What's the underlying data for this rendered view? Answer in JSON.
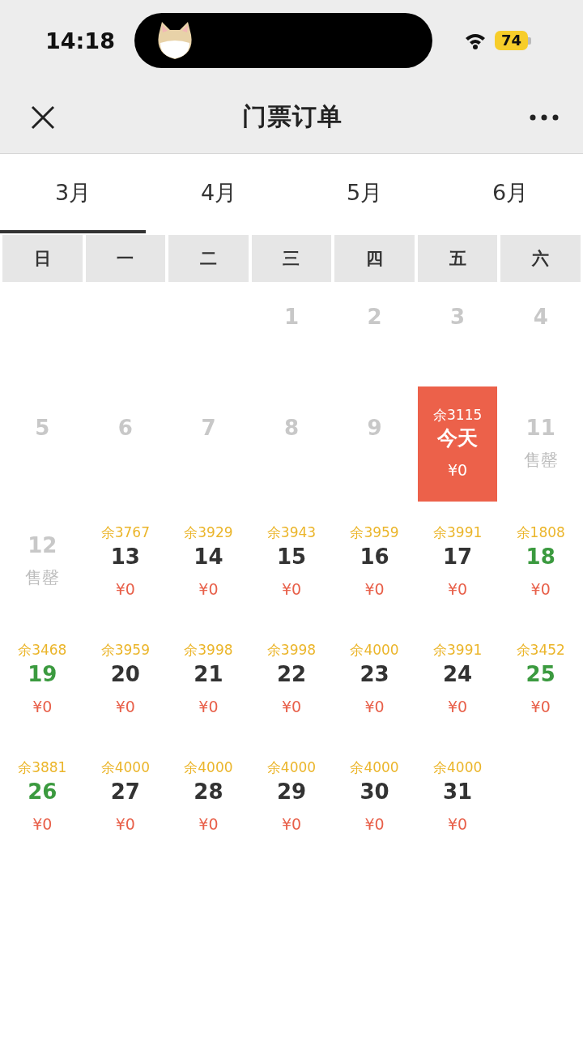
{
  "status_bar": {
    "time": "14:18",
    "battery": "74"
  },
  "nav_bar": {
    "title": "门票订单"
  },
  "month_tabs": [
    {
      "label": "3月",
      "selected": true
    },
    {
      "label": "4月",
      "selected": false
    },
    {
      "label": "5月",
      "selected": false
    },
    {
      "label": "6月",
      "selected": false
    }
  ],
  "weekdays": [
    "日",
    "一",
    "二",
    "三",
    "四",
    "五",
    "六"
  ],
  "weeks": [
    [
      {
        "kind": "empty"
      },
      {
        "kind": "empty"
      },
      {
        "kind": "empty"
      },
      {
        "kind": "past",
        "date": "1"
      },
      {
        "kind": "past",
        "date": "2"
      },
      {
        "kind": "past",
        "date": "3"
      },
      {
        "kind": "past",
        "date": "4"
      }
    ],
    [
      {
        "kind": "past",
        "date": "5"
      },
      {
        "kind": "past",
        "date": "6"
      },
      {
        "kind": "past",
        "date": "7"
      },
      {
        "kind": "past",
        "date": "8"
      },
      {
        "kind": "past",
        "date": "9"
      },
      {
        "kind": "today",
        "remaining": "余3115",
        "label": "今天",
        "price": "¥0"
      },
      {
        "kind": "soldout",
        "date": "11",
        "status": "售罄"
      }
    ],
    [
      {
        "kind": "soldout",
        "date": "12",
        "status": "售罄"
      },
      {
        "kind": "available",
        "remaining": "余3767",
        "date": "13",
        "weekend": false,
        "price": "¥0"
      },
      {
        "kind": "available",
        "remaining": "余3929",
        "date": "14",
        "weekend": false,
        "price": "¥0"
      },
      {
        "kind": "available",
        "remaining": "余3943",
        "date": "15",
        "weekend": false,
        "price": "¥0"
      },
      {
        "kind": "available",
        "remaining": "余3959",
        "date": "16",
        "weekend": false,
        "price": "¥0"
      },
      {
        "kind": "available",
        "remaining": "余3991",
        "date": "17",
        "weekend": false,
        "price": "¥0"
      },
      {
        "kind": "available",
        "remaining": "余1808",
        "date": "18",
        "weekend": true,
        "price": "¥0"
      }
    ],
    [
      {
        "kind": "available",
        "remaining": "余3468",
        "date": "19",
        "weekend": true,
        "price": "¥0"
      },
      {
        "kind": "available",
        "remaining": "余3959",
        "date": "20",
        "weekend": false,
        "price": "¥0"
      },
      {
        "kind": "available",
        "remaining": "余3998",
        "date": "21",
        "weekend": false,
        "price": "¥0"
      },
      {
        "kind": "available",
        "remaining": "余3998",
        "date": "22",
        "weekend": false,
        "price": "¥0"
      },
      {
        "kind": "available",
        "remaining": "余4000",
        "date": "23",
        "weekend": false,
        "price": "¥0"
      },
      {
        "kind": "available",
        "remaining": "余3991",
        "date": "24",
        "weekend": false,
        "price": "¥0"
      },
      {
        "kind": "available",
        "remaining": "余3452",
        "date": "25",
        "weekend": true,
        "price": "¥0"
      }
    ],
    [
      {
        "kind": "available",
        "remaining": "余3881",
        "date": "26",
        "weekend": true,
        "price": "¥0"
      },
      {
        "kind": "available",
        "remaining": "余4000",
        "date": "27",
        "weekend": false,
        "price": "¥0"
      },
      {
        "kind": "available",
        "remaining": "余4000",
        "date": "28",
        "weekend": false,
        "price": "¥0"
      },
      {
        "kind": "available",
        "remaining": "余4000",
        "date": "29",
        "weekend": false,
        "price": "¥0"
      },
      {
        "kind": "available",
        "remaining": "余4000",
        "date": "30",
        "weekend": false,
        "price": "¥0"
      },
      {
        "kind": "available",
        "remaining": "余4000",
        "date": "31",
        "weekend": false,
        "price": "¥0"
      },
      {
        "kind": "empty"
      }
    ]
  ]
}
